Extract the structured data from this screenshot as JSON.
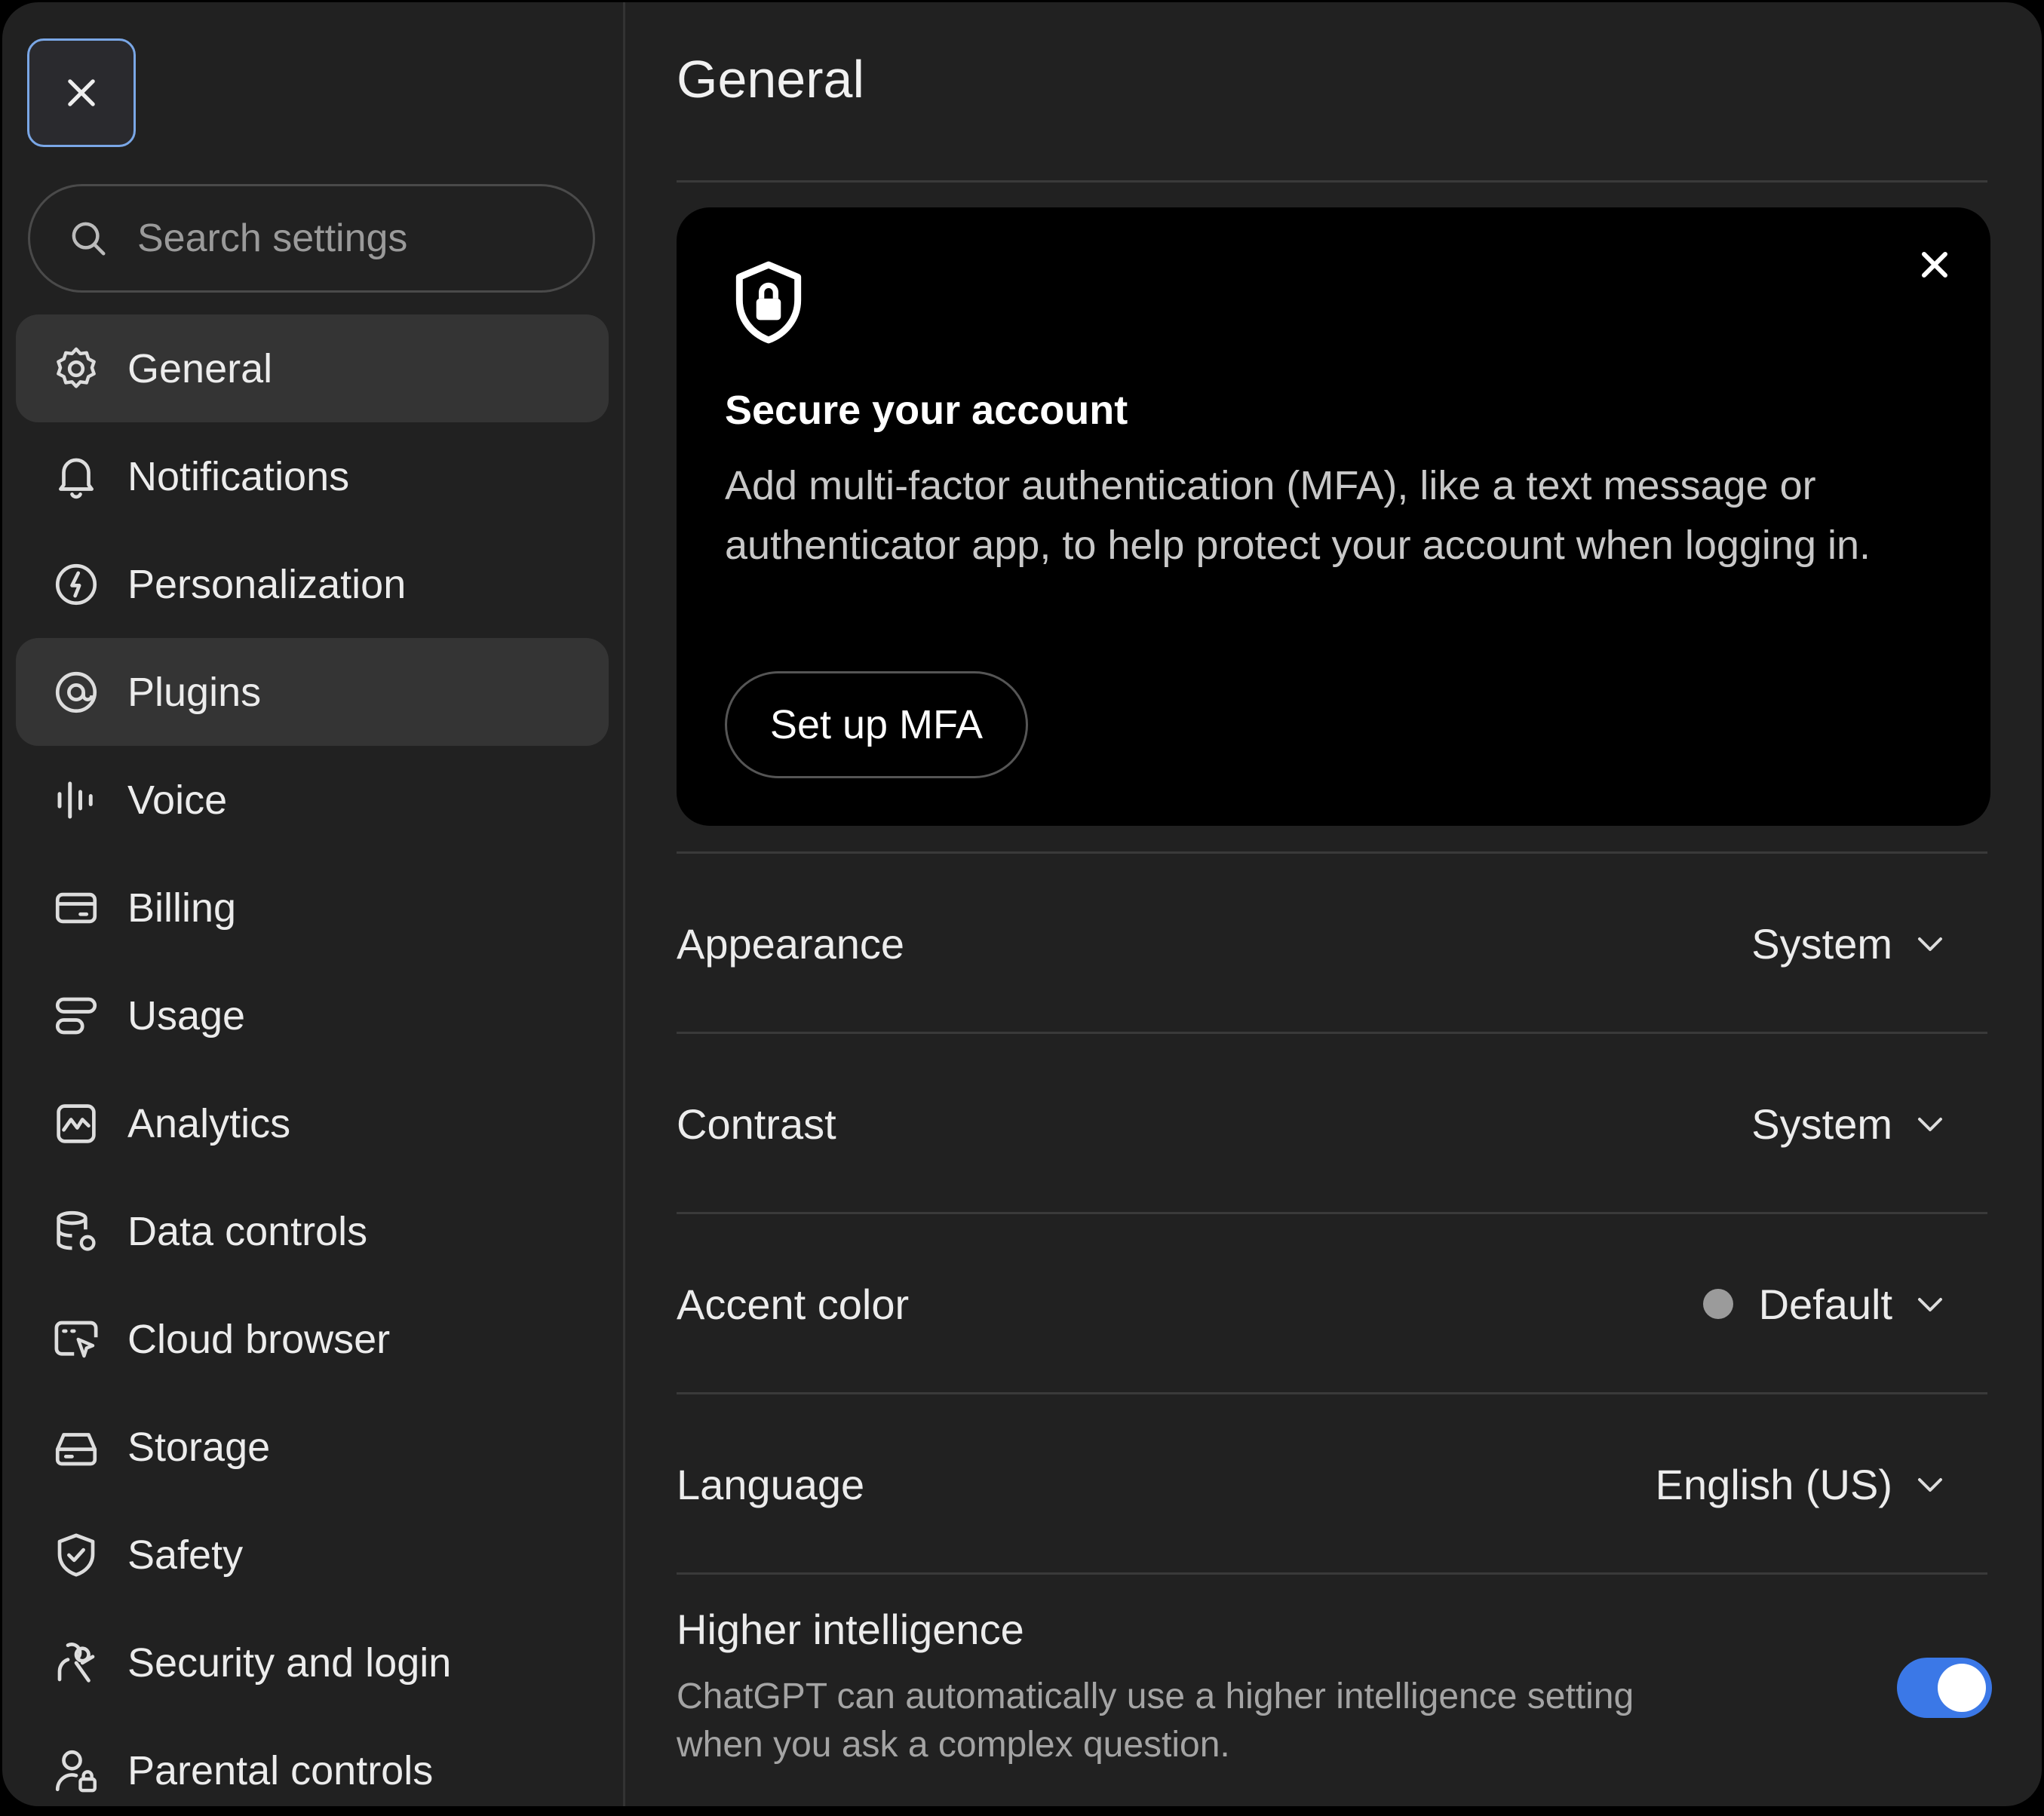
{
  "sidebar": {
    "search_placeholder": "Search settings",
    "items": [
      {
        "label": "General",
        "icon": "gear-icon",
        "active": true
      },
      {
        "label": "Notifications",
        "icon": "bell-icon"
      },
      {
        "label": "Personalization",
        "icon": "personalization-icon"
      },
      {
        "label": "Plugins",
        "icon": "plugins-icon",
        "hover": true
      },
      {
        "label": "Voice",
        "icon": "voice-waveform-icon"
      },
      {
        "label": "Billing",
        "icon": "credit-card-icon"
      },
      {
        "label": "Usage",
        "icon": "usage-icon"
      },
      {
        "label": "Analytics",
        "icon": "analytics-icon"
      },
      {
        "label": "Data controls",
        "icon": "database-gear-icon"
      },
      {
        "label": "Cloud browser",
        "icon": "cloud-browser-icon"
      },
      {
        "label": "Storage",
        "icon": "storage-icon"
      },
      {
        "label": "Safety",
        "icon": "shield-check-icon"
      },
      {
        "label": "Security and login",
        "icon": "security-icon"
      },
      {
        "label": "Parental controls",
        "icon": "parental-controls-icon"
      }
    ]
  },
  "main": {
    "title": "General",
    "mfa_card": {
      "heading": "Secure your account",
      "body": "Add multi-factor authentication (MFA), like a text message or authenticator app, to help protect your account when logging in.",
      "button": "Set up MFA"
    },
    "settings": [
      {
        "label": "Appearance",
        "value": "System"
      },
      {
        "label": "Contrast",
        "value": "System"
      },
      {
        "label": "Accent color",
        "value": "Default",
        "color": "#9b9b9b"
      },
      {
        "label": "Language",
        "value": "English (US)"
      }
    ],
    "higher_intelligence": {
      "title": "Higher intelligence",
      "description": "ChatGPT can automatically use a higher intelligence setting when you ask a complex question.",
      "enabled": true
    }
  },
  "colors": {
    "accent": "#3b78e7",
    "background": "#212121",
    "card": "#000000"
  }
}
